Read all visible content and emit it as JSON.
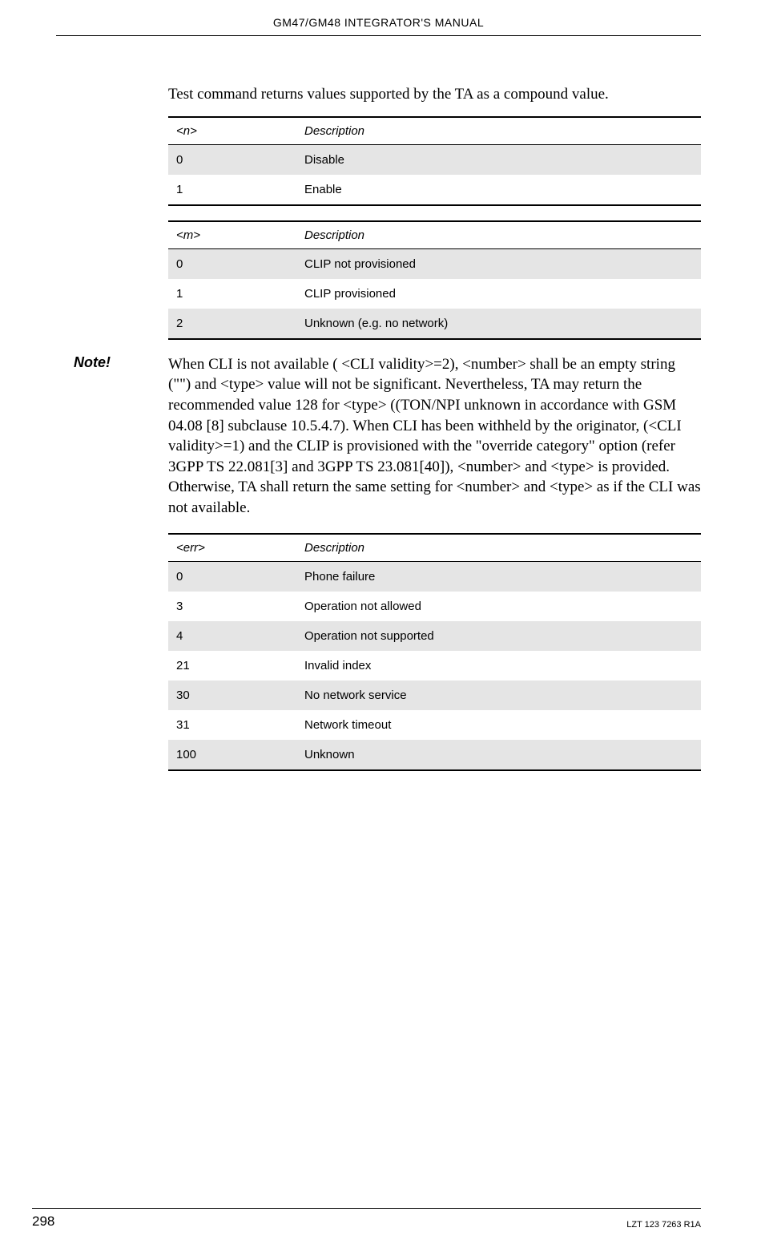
{
  "header": {
    "title": "GM47/GM48 INTEGRATOR'S MANUAL"
  },
  "intro_paragraph": "Test command returns values supported by the TA as a compound value.",
  "table_n": {
    "headers": [
      "<n>",
      "Description"
    ],
    "rows": [
      {
        "c1": "0",
        "c2": "Disable",
        "shaded": true
      },
      {
        "c1": "1",
        "c2": "Enable",
        "shaded": false
      }
    ]
  },
  "table_m": {
    "headers": [
      "<m>",
      "Description"
    ],
    "rows": [
      {
        "c1": "0",
        "c2": "CLIP not provisioned",
        "shaded": true
      },
      {
        "c1": "1",
        "c2": "CLIP provisioned",
        "shaded": false
      },
      {
        "c1": "2",
        "c2": "Unknown (e.g. no network)",
        "shaded": true
      }
    ]
  },
  "note": {
    "label": "Note!",
    "text": "When CLI is not available ( <CLI validity>=2), <number> shall be an empty string (\"\") and <type> value will not be significant. Nevertheless, TA may return the recommended value 128 for <type> ((TON/NPI unknown in accordance with GSM 04.08 [8] subclause 10.5.4.7). When CLI has been withheld by the originator, (<CLI validity>=1) and the CLIP is provisioned with the \"override category\" option (refer 3GPP TS 22.081[3] and 3GPP TS 23.081[40]), <number> and <type> is provided. Otherwise, TA shall return the same setting for <number> and <type> as if the CLI was not available."
  },
  "table_err": {
    "headers": [
      "<err>",
      "Description"
    ],
    "rows": [
      {
        "c1": "0",
        "c2": "Phone failure",
        "shaded": true
      },
      {
        "c1": "3",
        "c2": "Operation not allowed",
        "shaded": false
      },
      {
        "c1": "4",
        "c2": "Operation not supported",
        "shaded": true
      },
      {
        "c1": "21",
        "c2": "Invalid index",
        "shaded": false
      },
      {
        "c1": "30",
        "c2": "No network service",
        "shaded": true
      },
      {
        "c1": "31",
        "c2": "Network timeout",
        "shaded": false
      },
      {
        "c1": "100",
        "c2": "Unknown",
        "shaded": true
      }
    ]
  },
  "footer": {
    "page_number": "298",
    "doc_id": "LZT 123 7263 R1A"
  }
}
